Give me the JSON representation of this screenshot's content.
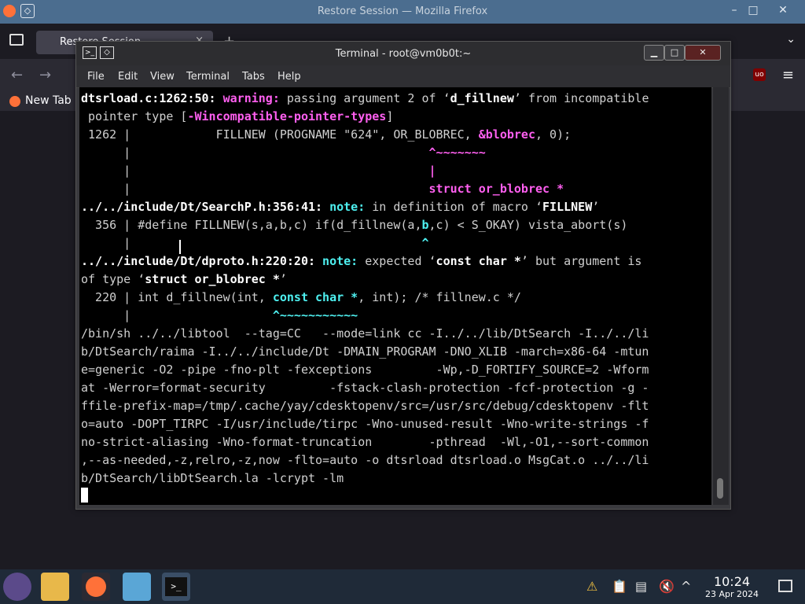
{
  "firefox": {
    "window_title": "Restore Session — Mozilla Firefox",
    "pin_glyph": "◇",
    "window_controls": [
      "–",
      "□",
      "✕"
    ],
    "tab_label": "Restore Session",
    "tab_close": "×",
    "new_tab_glyph": "+",
    "bookmark_label": "New Tab",
    "ublock_label": "uo",
    "back_glyph": "←",
    "forward_glyph": "→",
    "menu_glyph": "≡",
    "tab_list_glyph": "⌄"
  },
  "terminal": {
    "title": "Terminal - root@vm0b0t:~",
    "icon_glyph": ">_",
    "pin_glyph": "◇",
    "window_controls": [
      "▁",
      "□",
      "✕"
    ],
    "menu": [
      "File",
      "Edit",
      "View",
      "Terminal",
      "Tabs",
      "Help"
    ],
    "lines": {
      "l1a": "dtsrload.c:1262:50: ",
      "l1b": "warning: ",
      "l1c": "passing argument 2 of ‘",
      "l1d": "d_fillnew",
      "l1e": "’ from incompatible",
      "l2a": " pointer type [",
      "l2b": "-Wincompatible-pointer-types",
      "l2c": "]",
      "l3a": " 1262 |            FILLNEW (PROGNAME \"624\", OR_BLOBREC, ",
      "l3b": "&blobrec",
      "l3c": ", 0);",
      "l4a": "      |                                          ",
      "l4b": "^~~~~~~~",
      "l5a": "      |                                          ",
      "l5b": "|",
      "l6a": "      |                                          ",
      "l6b": "struct or_blobrec *",
      "l7a": "../../include/Dt/SearchP.h:356:41: ",
      "l7b": "note: ",
      "l7c": "in definition of macro ‘",
      "l7d": "FILLNEW",
      "l7e": "’",
      "l8a": "  356 | #define FILLNEW(s,a,b,c) if(d_fillnew(a,",
      "l8b": "b",
      "l8c": ",c) < S_OKAY) vista_abort(s)",
      "l9a": "      |                                         ",
      "l9b": "^",
      "l10a": "../../include/Dt/dproto.h:220:20: ",
      "l10b": "note: ",
      "l10c": "expected ‘",
      "l10d": "const char *",
      "l10e": "’ but argument is",
      "l11a": "of type ‘",
      "l11b": "struct or_blobrec *",
      "l11c": "’",
      "l12a": "  220 | int d_fillnew(int, ",
      "l12b": "const char *",
      "l12c": ", int); /* fillnew.c */",
      "l13a": "      |                    ",
      "l13b": "^~~~~~~~~~~~",
      "l14": "/bin/sh ../../libtool  --tag=CC   --mode=link cc -I../../lib/DtSearch -I../../li",
      "l15": "b/DtSearch/raima -I../../include/Dt -DMAIN_PROGRAM -DNO_XLIB -march=x86-64 -mtun",
      "l16": "e=generic -O2 -pipe -fno-plt -fexceptions         -Wp,-D_FORTIFY_SOURCE=2 -Wform",
      "l17": "at -Werror=format-security         -fstack-clash-protection -fcf-protection -g -",
      "l18": "ffile-prefix-map=/tmp/.cache/yay/cdesktopenv/src=/usr/src/debug/cdesktopenv -flt",
      "l19": "o=auto -DOPT_TIRPC -I/usr/include/tirpc -Wno-unused-result -Wno-write-strings -f",
      "l20": "no-strict-aliasing -Wno-format-truncation        -pthread  -Wl,-O1,--sort-common",
      "l21": ",--as-needed,-z,relro,-z,now -flto=auto -o dtsrload dtsrload.o MsgCat.o ../../li",
      "l22": "b/DtSearch/libDtSearch.la -lcrypt -lm"
    }
  },
  "taskbar": {
    "terminal_glyph": ">_",
    "tray_up_glyph": "^",
    "time": "10:24",
    "date": "23 Apr 2024"
  }
}
